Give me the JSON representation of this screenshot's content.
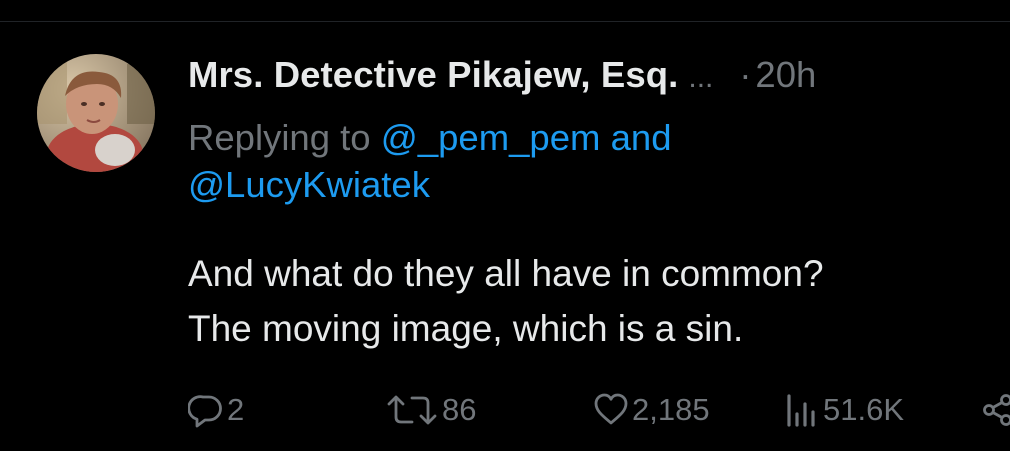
{
  "tweet": {
    "display_name": "Mrs. Detective Pikajew, Esq.",
    "truncation": "...",
    "separator": "·",
    "timestamp": "20h",
    "replying_prefix": "Replying to",
    "mention_1": "@_pem_pem",
    "and_word": "and",
    "mention_2": "@LucyKwiatek",
    "text_lines": [
      "And what do they all have in common?",
      "The moving image, which is a sin."
    ]
  },
  "actions": {
    "replies": {
      "icon": "reply-icon",
      "count": "2"
    },
    "reposts": {
      "icon": "repost-icon",
      "count": "86"
    },
    "likes": {
      "icon": "heart-icon",
      "count": "2,185"
    },
    "views": {
      "icon": "views-icon",
      "count": "51.6K"
    },
    "share": {
      "icon": "share-icon"
    }
  },
  "colors": {
    "background": "#000000",
    "primary_text": "#e7e9ea",
    "secondary_text": "#71767b",
    "mention": "#1d9bf0"
  }
}
